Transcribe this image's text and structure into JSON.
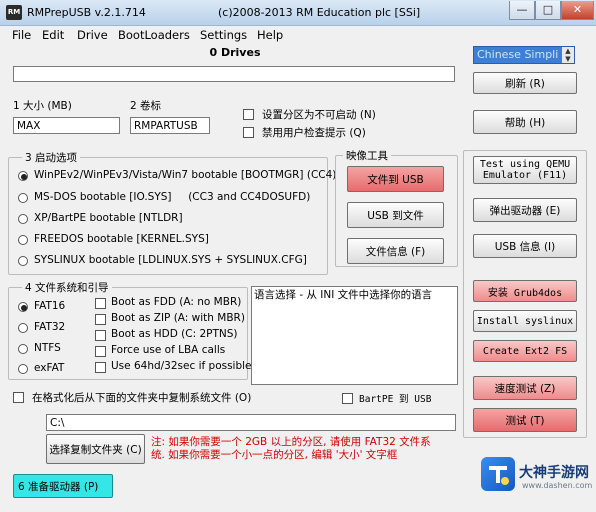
{
  "window": {
    "icon_text": "RM",
    "title": "RMPrepUSB v.2.1.714",
    "subtitle": "(c)2008-2013 RM Education plc [SSi]",
    "minimize": "—",
    "maximize": "□",
    "close": "✕"
  },
  "menu": [
    "File",
    "Edit",
    "Drive",
    "BootLoaders",
    "Settings",
    "Help"
  ],
  "drives": {
    "label": "0 Drives"
  },
  "language": {
    "selected": "Chinese Simpli"
  },
  "right_buttons": {
    "refresh": "刷新 (R)",
    "help": "帮助 (H)",
    "qemu": "Test using QEMU Emulator (F11)",
    "eject": "弹出驱动器 (E)",
    "usb_info": "USB 信息 (I)",
    "grub": "安装 Grub4dos",
    "syslinux": "Install syslinux",
    "ext2": "Create Ext2 FS",
    "speed": "速度测试 (Z)",
    "test": "测试 (T)"
  },
  "fields": {
    "size_label": "1 大小 (MB)",
    "size_value": "MAX",
    "volume_label": "2 卷标",
    "volume_value": "RMPARTUSB",
    "opt_non_bootable": "设置分区为不可启动 (N)",
    "opt_no_user_prompt": "禁用用户检查提示 (Q)"
  },
  "boot_options": {
    "title": "3 启动选项",
    "items": [
      {
        "label": "WinPEv2/WinPEv3/Vista/Win7 bootable [BOOTMGR] (CC4)",
        "selected": true
      },
      {
        "label": "MS-DOS bootable [IO.SYS]     (CC3 and CC4DOSUFD)",
        "selected": false
      },
      {
        "label": "XP/BartPE bootable [NTLDR]",
        "selected": false
      },
      {
        "label": "FREEDOS bootable [KERNEL.SYS]",
        "selected": false
      },
      {
        "label": "SYSLINUX bootable [LDLINUX.SYS + SYSLINUX.CFG]",
        "selected": false
      }
    ]
  },
  "image_tools": {
    "title": "映像工具",
    "file_to_usb": "文件到 USB",
    "usb_to_file": "USB 到文件",
    "file_info": "文件信息 (F)"
  },
  "filesystem": {
    "title": "4 文件系统和引导",
    "fs_options": [
      {
        "label": "FAT16",
        "selected": true
      },
      {
        "label": "FAT32",
        "selected": false
      },
      {
        "label": "NTFS",
        "selected": false
      },
      {
        "label": "exFAT",
        "selected": false
      }
    ],
    "boot_checks": [
      "Boot as FDD (A: no MBR)",
      "Boot as ZIP (A: with MBR)",
      "Boot as HDD (C: 2PTNS)",
      "Force use of LBA calls",
      "Use 64hd/32sec if possible"
    ]
  },
  "description": "语言选择 - 从 INI 文件中选择你的语言",
  "copy_files": {
    "label": "在格式化后从下面的文件夹中复制系统文件 (O)",
    "bartpe": "BartPE 到 USB",
    "path": "C:\\",
    "choose_button": "选择复制文件夹 (C)"
  },
  "notice": {
    "line1": "注: 如果你需要一个 2GB 以上的分区, 请使用 FAT32 文件系",
    "line2": "统. 如果你需要一个小一点的分区, 编辑 '大小' 文字框"
  },
  "prepare_button": "6 准备驱动器 (P)",
  "watermark": {
    "title": "大神手游网",
    "sub": "www.dashen.com"
  },
  "colors": {
    "accent_red": "#e46d6d",
    "accent_pink": "#f08b8b",
    "prepare_cyan": "#35e6e6"
  }
}
